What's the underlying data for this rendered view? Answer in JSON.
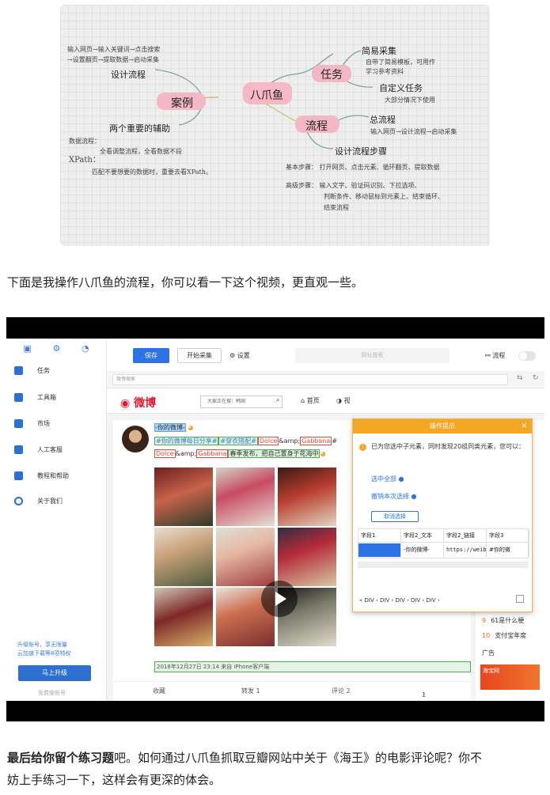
{
  "mindmap": {
    "center": "八爪鱼",
    "tasks": "任务",
    "simple": "简易采集",
    "simple_desc": "自带了简易模板，可用作",
    "simple_desc2": "学习参考资料",
    "custom": "自定义任务",
    "custom_desc": "大部分情况下使用",
    "flow": "流程",
    "total_flow": "总流程",
    "total_flow_desc": "输入网页→设计流程→启动采集",
    "design_steps": "设计流程步骤",
    "basic_steps": "基本步骤：  打开网页、点击元素、循环翻页、提取数据",
    "adv_steps_1": "高级步骤：  输入文字、验证码识别、下拉选项、",
    "adv_steps_2": "判断条件、移动鼠标到元素上、结束循环、",
    "adv_steps_3": "结束流程",
    "case": "案例",
    "case_note_1": "输入网页→输入关键词→点击搜索",
    "case_note_2": "→设置翻页→提取数据→启动采集",
    "design_flow": "设计流程",
    "two_aids": "两个重要的辅助",
    "data_flow": "数据流程：",
    "data_flow_desc": "全看调整流程，全看数据不段",
    "xpath": "XPath：",
    "xpath_desc": "匹配不要想要的数据时，重要去看XPath。"
  },
  "intro_text": "下面是我操作八爪鱼的流程，你可以看一下这个视频，更直观一些。",
  "video": {
    "sidebar": {
      "items": [
        {
          "label": "任务"
        },
        {
          "label": "工具箱"
        },
        {
          "label": "市场"
        },
        {
          "label": "人工客服"
        },
        {
          "label": "教程和帮助"
        },
        {
          "label": "关于我们"
        }
      ],
      "promo_1": "升级账号，享无限量",
      "promo_2": "云加速下载等8项特权",
      "upgrade": "马上升级",
      "footer": "免费版账号"
    },
    "toolbar": {
      "save": "保存",
      "start": "开始采集",
      "settings": "设置",
      "search_placeholder": "网址搜索",
      "flow": "流程"
    },
    "url": "微博搜索",
    "weibo": {
      "logo": "微博",
      "search": "大家正在搜：韩国",
      "home": "首页",
      "video": "视"
    },
    "post": {
      "author": "-你的微博-",
      "line1_a": "#你的微博每日分享#",
      "line1_b": "#穿衣搭配#",
      "line1_c": "Dolce",
      "line1_d": "&amp;",
      "line1_e": "Gabbana",
      "line1_f": "#",
      "line2_a": "Dolce",
      "line2_b": "&amp;",
      "line2_c": "Gabbana",
      "line2_d": "春季发布，把自己置身于花海中",
      "date": "2018年12月27日 23:14 来自 iPhone客户端",
      "collect": "收藏",
      "repost": "转发 1",
      "comment": "评论 2",
      "like": "1"
    },
    "hot": {
      "i9": "9",
      "t9": "61是什么梗",
      "i10": "10",
      "t10": "支付宝年度",
      "ad": "广告",
      "ad_brand": "海宝网"
    },
    "tip": {
      "title": "操作提示",
      "msg": "已为您选中子元素，同时发现20组同类元素，您可以：",
      "select_all": "选中全部",
      "deselect": "撤销本次选择",
      "cancel": "取消选择",
      "headers": [
        "字段1",
        "字段2_文本",
        "字段2_链接",
        "字段3"
      ],
      "row": [
        "",
        "-你的微博-",
        "https://weibo...",
        "#你的微"
      ],
      "crumb": "«  DIV  ›  DIV  ›  DIV  ›  DIV  ›  DIV  ›"
    }
  },
  "outro": {
    "bold": "最后给你留个练习题",
    "line1": "吧。如何通过八爪鱼抓取豆瓣网站中关于《海王》的电影评论呢？你不",
    "line2": "妨上手练习一下，这样会有更深的体会。"
  }
}
